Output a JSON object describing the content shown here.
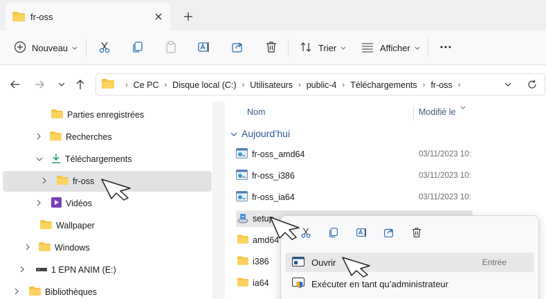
{
  "window": {
    "tab_title": "fr-oss",
    "colors": {
      "titlebar": "#efeff1",
      "accent": "#2b5797",
      "folder": "#f6c343"
    }
  },
  "toolbar": {
    "new_label": "Nouveau",
    "sort_label": "Trier",
    "view_label": "Afficher",
    "more_label": "..."
  },
  "address": {
    "crumbs": [
      "Ce PC",
      "Disque local (C:)",
      "Utilisateurs",
      "public-4",
      "Téléchargements",
      "fr-oss"
    ]
  },
  "sidebar": {
    "items": [
      {
        "label": "Parties enregistrées"
      },
      {
        "label": "Recherches"
      },
      {
        "label": "Téléchargements"
      },
      {
        "label": "fr-oss"
      },
      {
        "label": "Vidéos"
      },
      {
        "label": "Wallpaper"
      },
      {
        "label": "Windows"
      },
      {
        "label": "1 EPN ANIM (E:)"
      },
      {
        "label": "Bibliothèques"
      }
    ]
  },
  "filelist": {
    "col_name": "Nom",
    "col_modified": "Modifié le",
    "group": "Aujourd’hui",
    "files": [
      {
        "name": "fr-oss_amd64",
        "date": "03/11/2023 10:",
        "icon": "package-icon"
      },
      {
        "name": "fr-oss_i386",
        "date": "03/11/2023 10:",
        "icon": "package-icon"
      },
      {
        "name": "fr-oss_ia64",
        "date": "03/11/2023 10:",
        "icon": "package-icon"
      },
      {
        "name": "setup",
        "date": "",
        "icon": "setup-icon"
      },
      {
        "name": "amd64",
        "date": "",
        "icon": "folder-icon"
      },
      {
        "name": "i386",
        "date": "",
        "icon": "folder-icon"
      },
      {
        "name": "ia64",
        "date": "",
        "icon": "folder-icon"
      }
    ]
  },
  "context_menu": {
    "open_label": "Ouvrir",
    "open_accel": "Entrée",
    "runas_label": "Exécuter en tant qu’administrateur"
  }
}
